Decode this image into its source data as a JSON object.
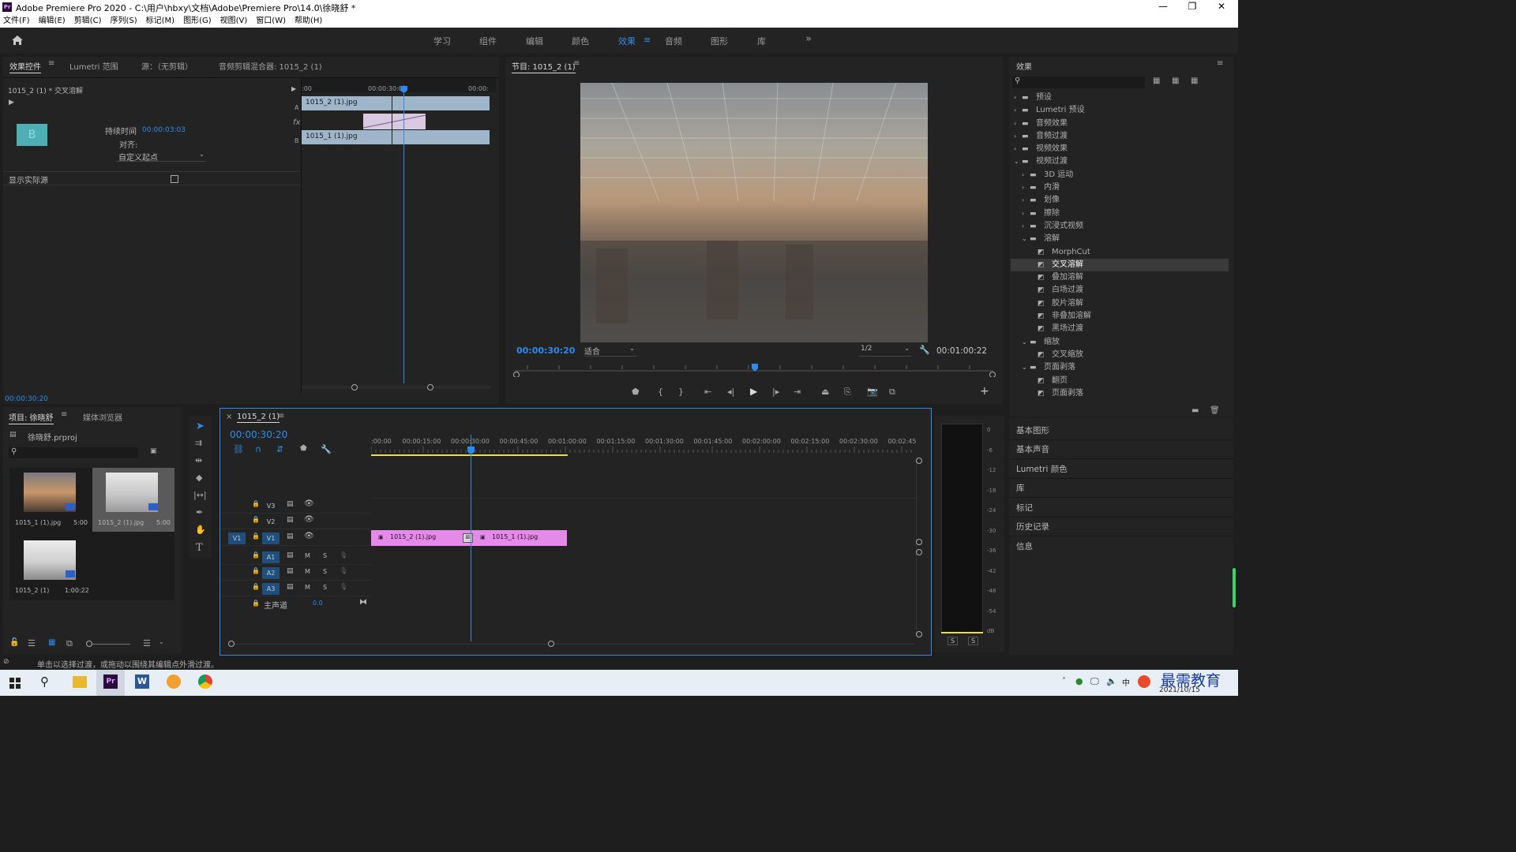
{
  "window": {
    "title": "Adobe Premiere Pro 2020 - C:\\用户\\hbxy\\文档\\Adobe\\Premiere Pro\\14.0\\徐晓舒 *",
    "minimize": "—",
    "maximize": "❐",
    "close": "✕"
  },
  "menu": [
    "文件(F)",
    "编辑(E)",
    "剪辑(C)",
    "序列(S)",
    "标记(M)",
    "图形(G)",
    "视图(V)",
    "窗口(W)",
    "帮助(H)"
  ],
  "workspaces": [
    "学习",
    "组件",
    "编辑",
    "颜色",
    "效果",
    "音频",
    "图形",
    "库"
  ],
  "ws_more": "»",
  "effect_controls": {
    "tabs": [
      "效果控件",
      "Lumetri 范围",
      "源：（无剪辑）",
      "音频剪辑混合器: 1015_2 (1)"
    ],
    "clip": "1015_2 (1) * 交叉溶解",
    "duration_label": "持续时间",
    "duration_value": "00:00:03:03",
    "align_label": "对齐:",
    "align_value": "自定义起点",
    "show_source_label": "显示实际源",
    "timecode": "00:00:30:20",
    "ruler": [
      ":00",
      "00:00:30:00",
      "00:00:"
    ],
    "clip_a": "1015_2 (1).jpg",
    "clip_b": "1015_1 (1).jpg",
    "track_a": "A",
    "track_b": "B",
    "fx": "fx",
    "thumb_letter": "B"
  },
  "program": {
    "title": "节目: 1015_2 (1)",
    "timecode": "00:00:30:20",
    "fit": "适合",
    "res": "1/2",
    "duration": "00:01:00:22"
  },
  "effects_panel": {
    "title": "效果",
    "items": [
      {
        "label": "预设",
        "lvl": 0,
        "t": "f",
        "o": false
      },
      {
        "label": "Lumetri 预设",
        "lvl": 0,
        "t": "f",
        "o": false
      },
      {
        "label": "音频效果",
        "lvl": 0,
        "t": "f",
        "o": false
      },
      {
        "label": "音频过渡",
        "lvl": 0,
        "t": "f",
        "o": false
      },
      {
        "label": "视频效果",
        "lvl": 0,
        "t": "f",
        "o": false
      },
      {
        "label": "视频过渡",
        "lvl": 0,
        "t": "f",
        "o": true
      },
      {
        "label": "3D 运动",
        "lvl": 1,
        "t": "f",
        "o": false
      },
      {
        "label": "内滑",
        "lvl": 1,
        "t": "f",
        "o": false
      },
      {
        "label": "划像",
        "lvl": 1,
        "t": "f",
        "o": false
      },
      {
        "label": "擦除",
        "lvl": 1,
        "t": "f",
        "o": false
      },
      {
        "label": "沉浸式视频",
        "lvl": 1,
        "t": "f",
        "o": false
      },
      {
        "label": "溶解",
        "lvl": 1,
        "t": "f",
        "o": true
      },
      {
        "label": "MorphCut",
        "lvl": 2,
        "t": "e"
      },
      {
        "label": "交叉溶解",
        "lvl": 2,
        "t": "e",
        "sel": true
      },
      {
        "label": "叠加溶解",
        "lvl": 2,
        "t": "e"
      },
      {
        "label": "白场过渡",
        "lvl": 2,
        "t": "e"
      },
      {
        "label": "胶片溶解",
        "lvl": 2,
        "t": "e"
      },
      {
        "label": "非叠加溶解",
        "lvl": 2,
        "t": "e"
      },
      {
        "label": "黑场过渡",
        "lvl": 2,
        "t": "e"
      },
      {
        "label": "缩放",
        "lvl": 1,
        "t": "f",
        "o": true
      },
      {
        "label": "交叉缩放",
        "lvl": 2,
        "t": "e"
      },
      {
        "label": "页面剥落",
        "lvl": 1,
        "t": "f",
        "o": true
      },
      {
        "label": "翻页",
        "lvl": 2,
        "t": "e"
      },
      {
        "label": "页面剥落",
        "lvl": 2,
        "t": "e"
      }
    ]
  },
  "side_panels": [
    "基本图形",
    "基本声音",
    "Lumetri 颜色",
    "库",
    "标记",
    "历史记录",
    "信息"
  ],
  "project": {
    "tabs": [
      "项目: 徐晓舒",
      "媒体浏览器"
    ],
    "file": "徐晓舒.prproj",
    "items": [
      {
        "name": "1015_1 (1).jpg",
        "dur": "5:00"
      },
      {
        "name": "1015_2 (1).jpg",
        "dur": "5:00"
      },
      {
        "name": "1015_2 (1)",
        "dur": "1:00:22"
      }
    ]
  },
  "timeline": {
    "tab": "1015_2 (1)",
    "timecode": "00:00:30:20",
    "ruler": [
      ":00:00",
      "00:00:15:00",
      "00:00:30:00",
      "00:00:45:00",
      "00:01:00:00",
      "00:01:15:00",
      "00:01:30:00",
      "00:01:45:00",
      "00:02:00:00",
      "00:02:15:00",
      "00:02:30:00",
      "00:02:45:"
    ],
    "vtracks": [
      "V3",
      "V2",
      "V1"
    ],
    "atracks": [
      "A1",
      "A2",
      "A3"
    ],
    "src_v": "V1",
    "m": "M",
    "s": "S",
    "master": "主声道",
    "master_val": "0.0",
    "clip1": "1015_2 (1).jpg",
    "clip2": "1015_1 (1).jpg"
  },
  "meter": {
    "ticks": [
      "0",
      "-6",
      "-12",
      "-18",
      "-24",
      "-30",
      "-36",
      "-42",
      "-48",
      "-54",
      "dB"
    ],
    "s1": "S",
    "s2": "S"
  },
  "status": "单击以选择过渡，或拖动以围绕其编辑点外滑过渡。",
  "taskbar": {
    "date": "2021/10/15",
    "brand": "最需教育",
    "ime": "中"
  },
  "colors": {
    "accent": "#2d8ceb",
    "clip_pink": "#e58ae8",
    "clip_blue": "#9fb5ca",
    "playhead": "#2d8ceb"
  }
}
